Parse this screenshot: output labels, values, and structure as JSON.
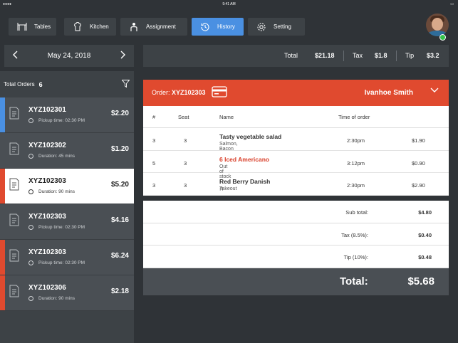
{
  "status": {
    "time": "9:41 AM"
  },
  "nav": [
    {
      "label": "Tables",
      "icon": "table-icon"
    },
    {
      "label": "Kitchen",
      "icon": "chef-icon"
    },
    {
      "label": "Assignment",
      "icon": "waiter-icon"
    },
    {
      "label": "History",
      "icon": "history-icon",
      "active": true
    },
    {
      "label": "Setting",
      "icon": "gear-icon"
    }
  ],
  "date": "May 24, 2018",
  "totals": {
    "total_label": "Total",
    "total": "$21.18",
    "tax_label": "Tax",
    "tax": "$1.8",
    "tip_label": "Tip",
    "tip": "$3.2"
  },
  "orders_panel": {
    "title": "Total Orders",
    "count": "6"
  },
  "orders": [
    {
      "id": "XYZ102301",
      "sub": "Pickup time: 02:30 PM",
      "price": "$2.20",
      "accent": "#4a90e2"
    },
    {
      "id": "XYZ102302",
      "sub": "Duration: 45 mins",
      "price": "$1.20",
      "accent": ""
    },
    {
      "id": "XYZ102303",
      "sub": "Duration: 90 mins",
      "price": "$5.20",
      "accent": "#e04a2f",
      "selected": true
    },
    {
      "id": "XYZ102303",
      "sub": "Pickup time: 02:30 PM",
      "price": "$4.16",
      "accent": ""
    },
    {
      "id": "XYZ102303",
      "sub": "Pickup time: 02:30 PM",
      "price": "$6.24",
      "accent": "#e04a2f"
    },
    {
      "id": "XYZ102306",
      "sub": "Duration: 90 mins",
      "price": "$2.18",
      "accent": "#e04a2f"
    }
  ],
  "detail": {
    "order_label": "Order:",
    "order_id": "XYZ102303",
    "customer": "Ivanhoe Smith",
    "columns": {
      "num": "#",
      "seat": "Seat",
      "name": "Name",
      "time": "Time of order"
    },
    "items": [
      {
        "num": "3",
        "seat": "3",
        "name": "Tasty vegetable salad",
        "note": "Salmon, Bacon",
        "time": "2:30pm",
        "price": "$1.90",
        "alert": false
      },
      {
        "num": "5",
        "seat": "3",
        "name": "6 Iced Americano",
        "note": "Out of stock",
        "time": "3:12pm",
        "price": "$0.90",
        "alert": true
      },
      {
        "num": "3",
        "seat": "3",
        "name": "Red Berry Danish",
        "note": "Takeout",
        "time": "2:30pm",
        "price": "$2.90",
        "alert": false
      }
    ],
    "summary": [
      {
        "label": "Sub total:",
        "value": "$4.80"
      },
      {
        "label": "Tax (8.5%):",
        "value": "$0.40"
      },
      {
        "label": "Tip (10%):",
        "value": "$0.48"
      }
    ],
    "total_label": "Total:",
    "total_value": "$5.68"
  },
  "colors": {
    "accent_blue": "#4a90e2",
    "accent_red": "#e04a2f",
    "bg_dark": "#2f3337",
    "panel": "#3d4246"
  }
}
